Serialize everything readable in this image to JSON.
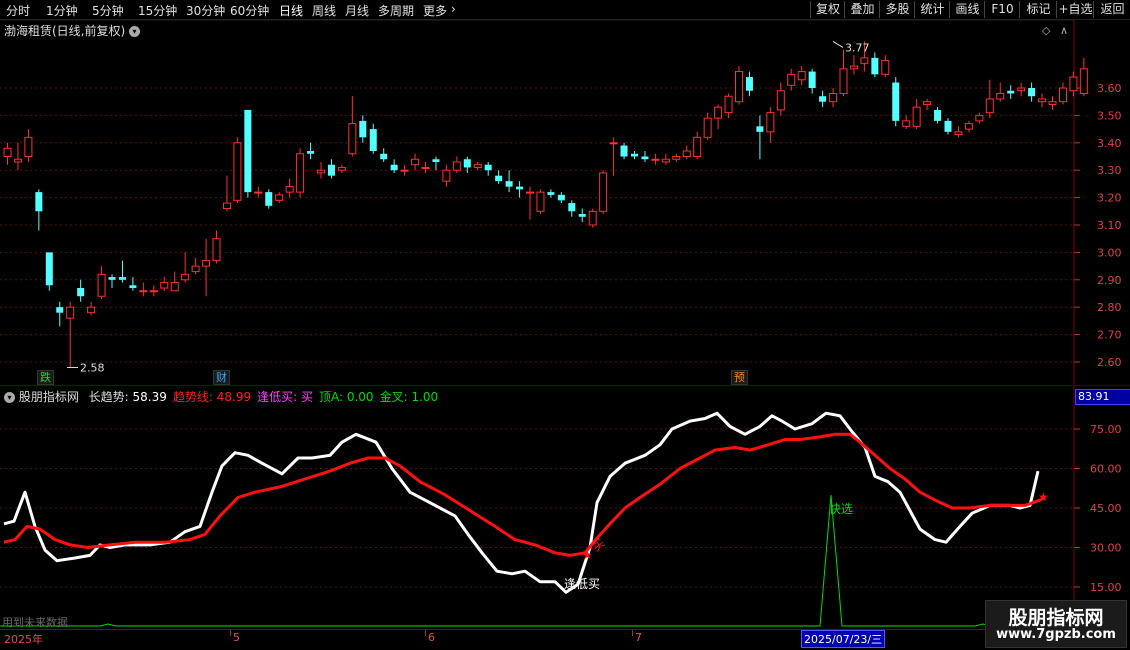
{
  "toolbar": {
    "left_items": [
      "分时",
      "1分钟",
      "5分钟",
      "15分钟",
      "30分钟",
      "60分钟",
      "日线",
      "周线",
      "月线",
      "多周期",
      "更多"
    ],
    "active_item": "日线",
    "more_arrow": "›",
    "right_items": [
      "复权",
      "叠加",
      "多股",
      "统计",
      "画线",
      "F10",
      "标记",
      "+自选",
      "返回"
    ]
  },
  "main": {
    "title": "渤海租赁(日线,前复权)",
    "price_axis": [
      "3.60",
      "3.50",
      "3.40",
      "3.30",
      "3.20",
      "3.10",
      "3.00",
      "2.90",
      "2.80",
      "2.70",
      "2.60"
    ],
    "high_label": "3.77",
    "low_label": "2.58",
    "markers": [
      {
        "text": "跌",
        "color": "#33cc33"
      },
      {
        "text": "财",
        "color": "#33aaff"
      },
      {
        "text": "预",
        "color": "#ff8800"
      }
    ]
  },
  "indicator": {
    "name": "股朋指标网",
    "values": [
      {
        "label": "长趋势:",
        "value": "58.39",
        "color": "#ffffff"
      },
      {
        "label": "趋势线:",
        "value": "48.99",
        "color": "#ff2020"
      },
      {
        "label": "逢低买:",
        "value": "买",
        "color": "#ff40ff"
      },
      {
        "label": "顶A:",
        "value": "0.00",
        "color": "#00dd00"
      },
      {
        "label": "金叉:",
        "value": "1.00",
        "color": "#00dd00"
      }
    ],
    "axis": [
      "75.00",
      "60.00",
      "45.00",
      "30.00",
      "15.00"
    ],
    "current_value": "83.91",
    "signals": {
      "buy_low": "逢低买",
      "buy": "买",
      "quick_pick": "快选"
    },
    "footer_note": "用到未来数据"
  },
  "dates": [
    "2025年",
    "5",
    "6",
    "7",
    "2025/07/23/三"
  ],
  "watermark": {
    "title": "股朋指标网",
    "url": "www.7gpzb.com"
  },
  "colors": {
    "up": "#ff3030",
    "down": "#54ffff",
    "trend": "#ff1010",
    "long": "#ffffff",
    "quick": "#00dd00"
  }
}
